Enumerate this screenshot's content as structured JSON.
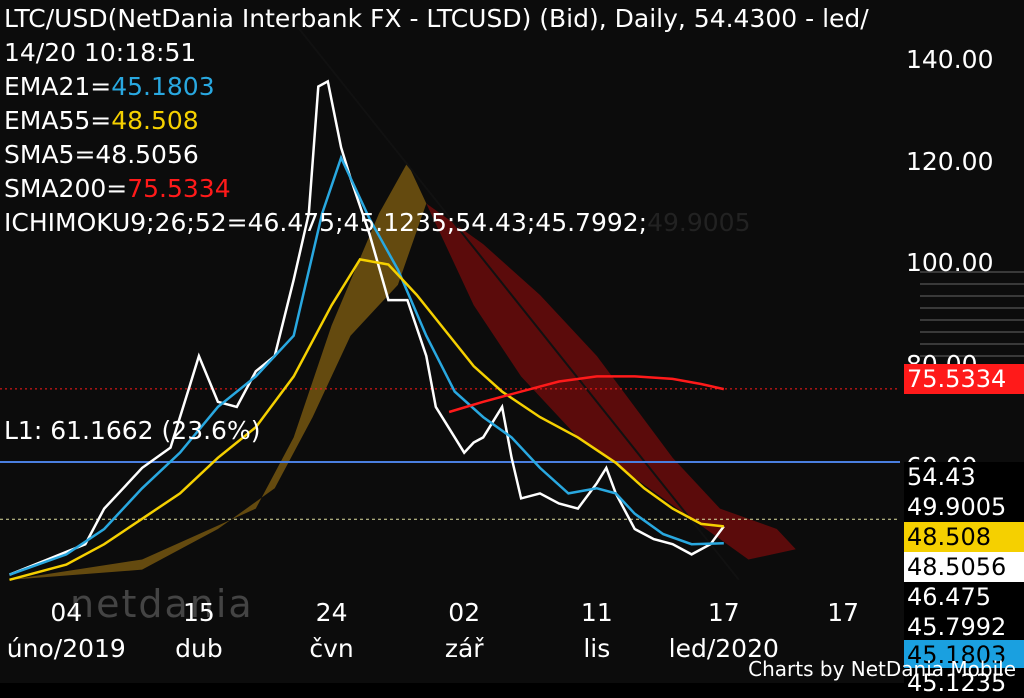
{
  "header": {
    "title_line1": "LTC/USD(NetDania Interbank FX - LTCUSD) (Bid),  Daily, 54.4300 - led/",
    "title_line2": "14/20 10:18:51",
    "ema21_label": "EMA21=",
    "ema21_value": "45.1803",
    "ema55_label": "EMA55=",
    "ema55_value": "48.508",
    "sma5": "SMA5=48.5056",
    "sma200_label": "SMA200=",
    "sma200_value": "75.5334",
    "ichimoku": "ICHIMOKU9;26;52=46.475;45.1235;54.43;45.7992;",
    "ichimoku_extra": "49.9005"
  },
  "fib_label": "L1: 61.1662 (23.6%)",
  "price_tags": [
    {
      "text": "75.5334",
      "bg": "#ff1a1a",
      "fg": "#ffffff"
    },
    {
      "text": "54.43",
      "bg": "#000000",
      "fg": "#ffffff"
    },
    {
      "text": "49.9005",
      "bg": "#000000",
      "fg": "#ffffff"
    },
    {
      "text": "48.508",
      "bg": "#f5d000",
      "fg": "#000000"
    },
    {
      "text": "48.5056",
      "bg": "#ffffff",
      "fg": "#000000"
    },
    {
      "text": "46.475",
      "bg": "#000000",
      "fg": "#ffffff"
    },
    {
      "text": "45.7992",
      "bg": "#000000",
      "fg": "#ffffff"
    },
    {
      "text": "45.1803",
      "bg": "#1aa0e0",
      "fg": "#000000"
    },
    {
      "text": "45.1235",
      "bg": "#000000",
      "fg": "#ffffff"
    }
  ],
  "footer": "Charts by NetDania Mobile",
  "watermark": "netdania",
  "colors": {
    "ema21": "#29a8e0",
    "ema55": "#f5d000",
    "sma5": "#ffffff",
    "sma200": "#ff1a1a",
    "fib_line": "#4a7fe0",
    "cloud_bull": "#7a5a10",
    "cloud_bear": "#6a0c0c",
    "candle_up": "#2ecc40",
    "candle_down": "#e01818"
  },
  "chart_data": {
    "type": "line",
    "symbol": "LTC/USD",
    "timeframe": "Daily",
    "y_ticks": [
      60,
      80,
      100,
      120,
      140
    ],
    "y_tick_labels": [
      "60.00",
      "80.00",
      "100.00",
      "120.00",
      "140.00"
    ],
    "ylim": [
      36,
      152
    ],
    "x_ticks": [
      {
        "day": "04",
        "month": "úno/2019",
        "t": 0
      },
      {
        "day": "15",
        "month": "dub",
        "t": 70
      },
      {
        "day": "24",
        "month": "čvn",
        "t": 140
      },
      {
        "day": "02",
        "month": "zář",
        "t": 210
      },
      {
        "day": "11",
        "month": "lis",
        "t": 280
      },
      {
        "day": "17",
        "month": "led/2020",
        "t": 347
      },
      {
        "day": "17",
        "month": "",
        "t": 410
      }
    ],
    "xlim": [
      -35,
      440
    ],
    "fib_level": 61.1662,
    "series": [
      {
        "name": "SMA5",
        "color": "#ffffff",
        "points": [
          [
            -30,
            39
          ],
          [
            -10,
            42
          ],
          [
            10,
            45
          ],
          [
            20,
            52
          ],
          [
            30,
            56
          ],
          [
            40,
            60
          ],
          [
            55,
            64
          ],
          [
            65,
            76
          ],
          [
            70,
            82
          ],
          [
            80,
            73
          ],
          [
            90,
            72
          ],
          [
            100,
            79
          ],
          [
            110,
            82
          ],
          [
            120,
            97
          ],
          [
            128,
            110
          ],
          [
            133,
            135
          ],
          [
            138,
            136
          ],
          [
            145,
            123
          ],
          [
            150,
            117
          ],
          [
            160,
            106
          ],
          [
            170,
            93
          ],
          [
            180,
            93
          ],
          [
            190,
            82
          ],
          [
            195,
            72
          ],
          [
            200,
            69
          ],
          [
            210,
            63
          ],
          [
            215,
            65
          ],
          [
            220,
            66
          ],
          [
            230,
            72
          ],
          [
            235,
            62
          ],
          [
            240,
            54
          ],
          [
            250,
            55
          ],
          [
            260,
            53
          ],
          [
            270,
            52
          ],
          [
            280,
            57
          ],
          [
            285,
            60
          ],
          [
            290,
            55
          ],
          [
            300,
            48
          ],
          [
            310,
            46
          ],
          [
            320,
            45
          ],
          [
            330,
            43
          ],
          [
            340,
            45
          ],
          [
            347,
            48.5
          ]
        ]
      },
      {
        "name": "EMA21",
        "color": "#29a8e0",
        "points": [
          [
            -30,
            39
          ],
          [
            0,
            43
          ],
          [
            20,
            48
          ],
          [
            40,
            56
          ],
          [
            60,
            63
          ],
          [
            80,
            72
          ],
          [
            100,
            78
          ],
          [
            120,
            86
          ],
          [
            135,
            110
          ],
          [
            145,
            121
          ],
          [
            160,
            109
          ],
          [
            175,
            99
          ],
          [
            190,
            86
          ],
          [
            205,
            75
          ],
          [
            220,
            70
          ],
          [
            235,
            66
          ],
          [
            250,
            60
          ],
          [
            265,
            55
          ],
          [
            280,
            56
          ],
          [
            290,
            55
          ],
          [
            300,
            51
          ],
          [
            315,
            47
          ],
          [
            330,
            45
          ],
          [
            347,
            45.18
          ]
        ]
      },
      {
        "name": "EMA55",
        "color": "#f5d000",
        "points": [
          [
            -30,
            38
          ],
          [
            0,
            41
          ],
          [
            20,
            45
          ],
          [
            40,
            50
          ],
          [
            60,
            55
          ],
          [
            80,
            62
          ],
          [
            100,
            68
          ],
          [
            120,
            78
          ],
          [
            140,
            92
          ],
          [
            155,
            101
          ],
          [
            170,
            100
          ],
          [
            185,
            94
          ],
          [
            200,
            87
          ],
          [
            215,
            80
          ],
          [
            230,
            75
          ],
          [
            250,
            70
          ],
          [
            270,
            66
          ],
          [
            290,
            61
          ],
          [
            305,
            56
          ],
          [
            320,
            52
          ],
          [
            335,
            49
          ],
          [
            347,
            48.5
          ]
        ]
      },
      {
        "name": "SMA200",
        "color": "#ff1a1a",
        "points": [
          [
            202,
            71
          ],
          [
            220,
            73
          ],
          [
            240,
            75
          ],
          [
            260,
            77
          ],
          [
            280,
            78
          ],
          [
            300,
            78
          ],
          [
            320,
            77.5
          ],
          [
            335,
            76.5
          ],
          [
            347,
            75.5
          ]
        ]
      }
    ]
  }
}
